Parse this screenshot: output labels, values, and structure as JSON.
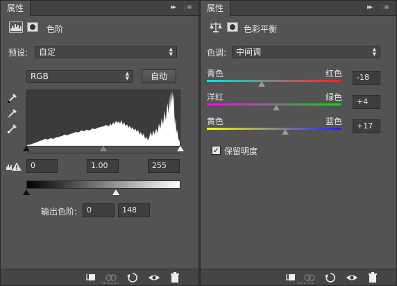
{
  "left_panel": {
    "tab_label": "属性",
    "title": "色阶",
    "preset_label": "预设:",
    "preset_value": "自定",
    "channel_value": "RGB",
    "auto_button": "自动",
    "input_levels": {
      "black": "0",
      "gamma": "1.00",
      "white": "255"
    },
    "output_label": "输出色阶:",
    "output_levels": {
      "black": "0",
      "white": "148"
    }
  },
  "right_panel": {
    "tab_label": "属性",
    "title": "色彩平衡",
    "tone_label": "色调:",
    "tone_value": "中间调",
    "sliders": [
      {
        "left": "青色",
        "right": "红色",
        "value": "-18",
        "colors": [
          "#00e6e6",
          "#ff2020"
        ],
        "level": -18
      },
      {
        "left": "洋红",
        "right": "绿色",
        "value": "+4",
        "colors": [
          "#ff00ff",
          "#00e600"
        ],
        "level": 4
      },
      {
        "left": "黄色",
        "right": "蓝色",
        "value": "+17",
        "colors": [
          "#ffff00",
          "#2020ff"
        ],
        "level": 17
      }
    ],
    "preserve_label": "保留明度",
    "preserve_checked": true
  }
}
